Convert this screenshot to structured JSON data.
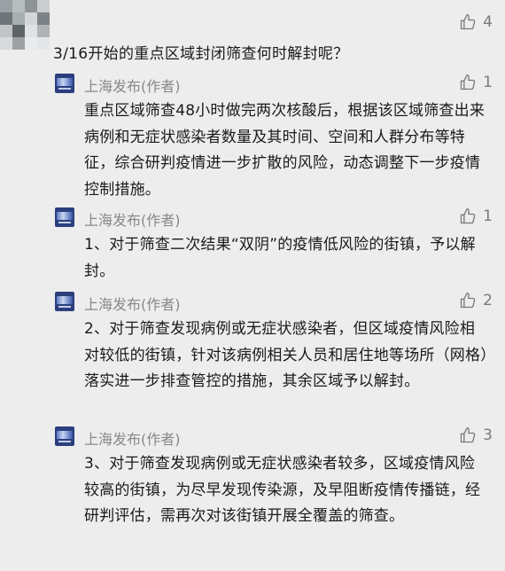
{
  "top_comment": {
    "text": "3/16开始的重点区域封闭筛查何时解封呢？",
    "likes": "4"
  },
  "replies": [
    {
      "author": "上海发布(作者)",
      "likes": "1",
      "text": "重点区域筛查48小时做完两次核酸后，根据该区域筛查出来病例和无症状感染者数量及其时间、空间和人群分布等特征，综合研判疫情进一步扩散的风险，动态调整下一步疫情控制措施。"
    },
    {
      "author": "上海发布(作者)",
      "likes": "1",
      "text": "1、对于筛查二次结果“双阴”的疫情低风险的街镇，予以解封。"
    },
    {
      "author": "上海发布(作者)",
      "likes": "2",
      "text": "2、对于筛查发现病例或无症状感染者，但区域疫情风险相对较低的街镇，针对该病例相关人员和居住地等场所（网格）落实进一步排查管控的措施，其余区域予以解封。"
    },
    {
      "author": "上海发布(作者)",
      "likes": "3",
      "text": "3、对于筛查发现病例或无症状感染者较多，区域疫情风险较高的街镇，为尽早发现传染源，及早阻断疫情传播链，经研判评估，需再次对该街镇开展全覆盖的筛查。"
    }
  ],
  "icons": {
    "like": "thumbs-up-icon",
    "commenter_avatar": "pixelated-avatar",
    "author_avatar": "shanghai-fabu-logo"
  }
}
